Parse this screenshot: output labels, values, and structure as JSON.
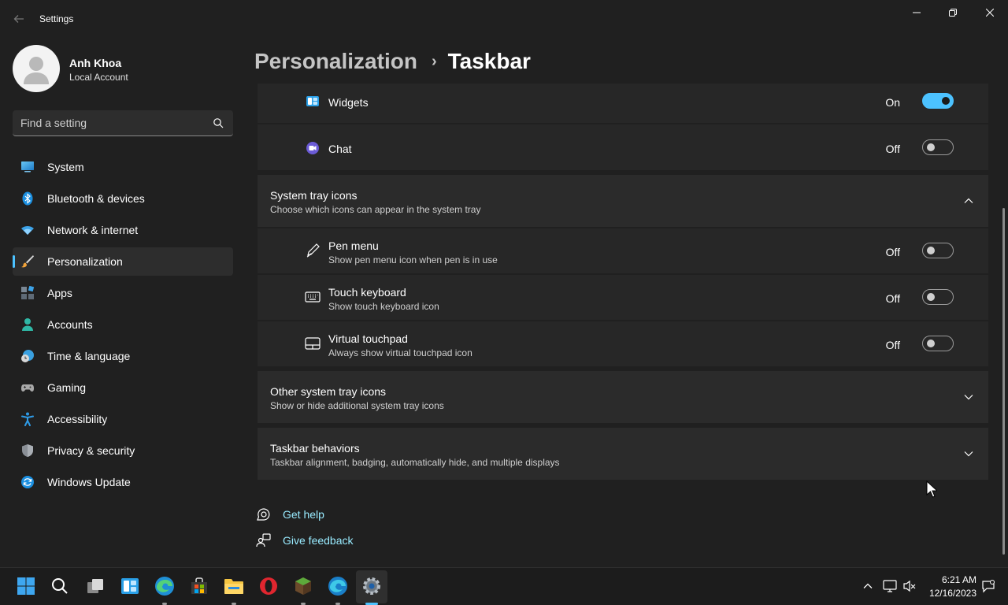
{
  "window": {
    "title": "Settings"
  },
  "user": {
    "name": "Anh Khoa",
    "account_type": "Local Account"
  },
  "search": {
    "placeholder": "Find a setting"
  },
  "nav": [
    {
      "label": "System",
      "icon": "monitor-icon"
    },
    {
      "label": "Bluetooth & devices",
      "icon": "bluetooth-icon"
    },
    {
      "label": "Network & internet",
      "icon": "wifi-icon"
    },
    {
      "label": "Personalization",
      "icon": "brush-icon",
      "active": true
    },
    {
      "label": "Apps",
      "icon": "apps-icon"
    },
    {
      "label": "Accounts",
      "icon": "person-icon"
    },
    {
      "label": "Time & language",
      "icon": "globe-clock-icon"
    },
    {
      "label": "Gaming",
      "icon": "gamepad-icon"
    },
    {
      "label": "Accessibility",
      "icon": "accessibility-icon"
    },
    {
      "label": "Privacy & security",
      "icon": "shield-icon"
    },
    {
      "label": "Windows Update",
      "icon": "refresh-icon"
    }
  ],
  "breadcrumb": {
    "parent": "Personalization",
    "separator": "›",
    "current": "Taskbar"
  },
  "taskbar_items": {
    "widgets": {
      "label": "Widgets",
      "state": "On",
      "on": true
    },
    "chat": {
      "label": "Chat",
      "state": "Off",
      "on": false
    }
  },
  "system_tray": {
    "title": "System tray icons",
    "description": "Choose which icons can appear in the system tray",
    "expanded": true,
    "items": {
      "pen_menu": {
        "label": "Pen menu",
        "description": "Show pen menu icon when pen is in use",
        "state": "Off",
        "on": false
      },
      "touch_keyboard": {
        "label": "Touch keyboard",
        "description": "Show touch keyboard icon",
        "state": "Off",
        "on": false
      },
      "virtual_touchpad": {
        "label": "Virtual touchpad",
        "description": "Always show virtual touchpad icon",
        "state": "Off",
        "on": false
      }
    }
  },
  "other_tray": {
    "title": "Other system tray icons",
    "description": "Show or hide additional system tray icons"
  },
  "behaviors": {
    "title": "Taskbar behaviors",
    "description": "Taskbar alignment, badging, automatically hide, and multiple displays"
  },
  "help": {
    "get_help": "Get help",
    "feedback": "Give feedback"
  },
  "clock": {
    "time": "6:21 AM",
    "date": "12/16/2023"
  },
  "colors": {
    "accent": "#4cc2ff",
    "background": "#202020",
    "card": "#2b2b2b",
    "link": "#99ebff"
  }
}
